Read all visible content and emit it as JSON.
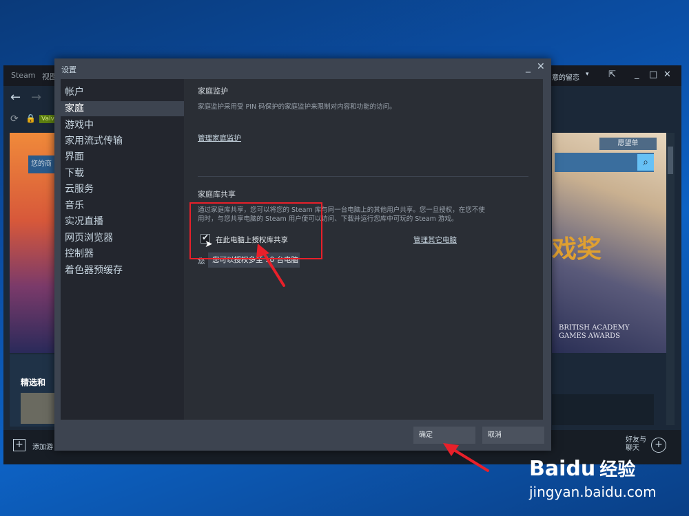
{
  "background_window": {
    "title": "Steam",
    "title_partial": "视图",
    "store_search_placeholder": "您的商",
    "wishlist_label": "愿望单",
    "notifications_label": "意的留恋",
    "badge_label": "Valv",
    "featured_label": "精选和",
    "banner_text_big": "戏奖",
    "banner_text_small_1": "BRITISH ACADEMY",
    "banner_text_small_2": "GAMES AWARDS",
    "add_game_label": "添加游",
    "friends_chat_label_1": "好友与",
    "friends_chat_label_2": "聊天"
  },
  "dialog": {
    "title": "设置",
    "minimize": "_",
    "close": "✕",
    "nav": [
      {
        "label": "帐户"
      },
      {
        "label": "家庭"
      },
      {
        "label": "游戏中"
      },
      {
        "label": "家用流式传输"
      },
      {
        "label": "界面"
      },
      {
        "label": "下载"
      },
      {
        "label": "云服务"
      },
      {
        "label": "音乐"
      },
      {
        "label": "实况直播"
      },
      {
        "label": "网页浏览器"
      },
      {
        "label": "控制器"
      },
      {
        "label": "着色器预缓存"
      }
    ],
    "active_nav": "家庭",
    "family_view": {
      "title": "家庭监护",
      "description": "家庭监护采用受 PIN 码保护的家庭监护来限制对内容和功能的访问。",
      "manage_link": "管理家庭监护"
    },
    "library_sharing": {
      "title": "家庭库共享",
      "description_1": "通过家庭库共享，您可以将您的 Steam 库与同一台电脑上的其他用户共享。您一旦授权，在您不使",
      "description_2": "用时，与您共享电脑的 Steam 用户便可以访问、下载并运行您库中可玩的 Steam 游戏。",
      "checkbox_label": "在此电脑上授权库共享",
      "checkbox_checked": true,
      "manage_other_link": "管理其它电脑",
      "limit_prefix": "您",
      "limit_text": "您可以授权多至 10 台电脑"
    },
    "ok_button": "确定",
    "cancel_button": "取消"
  },
  "watermark": {
    "brand": "Bai",
    "brand_2": "du",
    "brand_3": "经验",
    "url": "jingyan.baidu.com"
  },
  "colors": {
    "annotation_red": "#e8202a",
    "dialog_bg": "#3d4450",
    "content_bg": "#2a2e35",
    "sidebar_bg": "#23262e"
  }
}
